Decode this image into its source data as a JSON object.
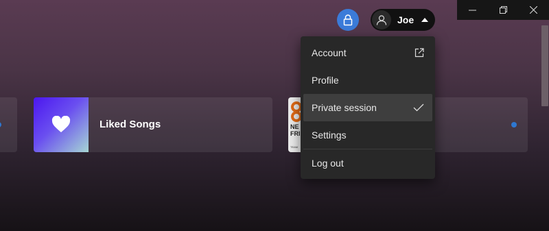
{
  "window": {
    "minimize_icon": "minimize-icon",
    "restore_icon": "restore-icon",
    "close_icon": "close-icon"
  },
  "header": {
    "lock_icon": "lock-icon",
    "user": {
      "name": "Joe",
      "avatar_icon": "user-icon",
      "caret_icon": "caret-up-icon"
    }
  },
  "cards": [
    {
      "title": "Liked Songs",
      "art_icon": "heart-icon"
    },
    {
      "art_text_lines": [
        "NE",
        "FRI"
      ],
      "art_small_text": "TEAM"
    }
  ],
  "menu": {
    "items": [
      {
        "label": "Account",
        "trailing_icon": "external-link-icon"
      },
      {
        "label": "Profile"
      },
      {
        "label": "Private session",
        "trailing_icon": "check-icon",
        "checked": true
      },
      {
        "label": "Settings"
      },
      {
        "label": "Log out"
      }
    ]
  },
  "colors": {
    "accent_blue": "#3b7bd9",
    "indicator_dot": "#2e77d0",
    "menu_bg": "#282828",
    "menu_active_bg": "#3e3e3e"
  }
}
